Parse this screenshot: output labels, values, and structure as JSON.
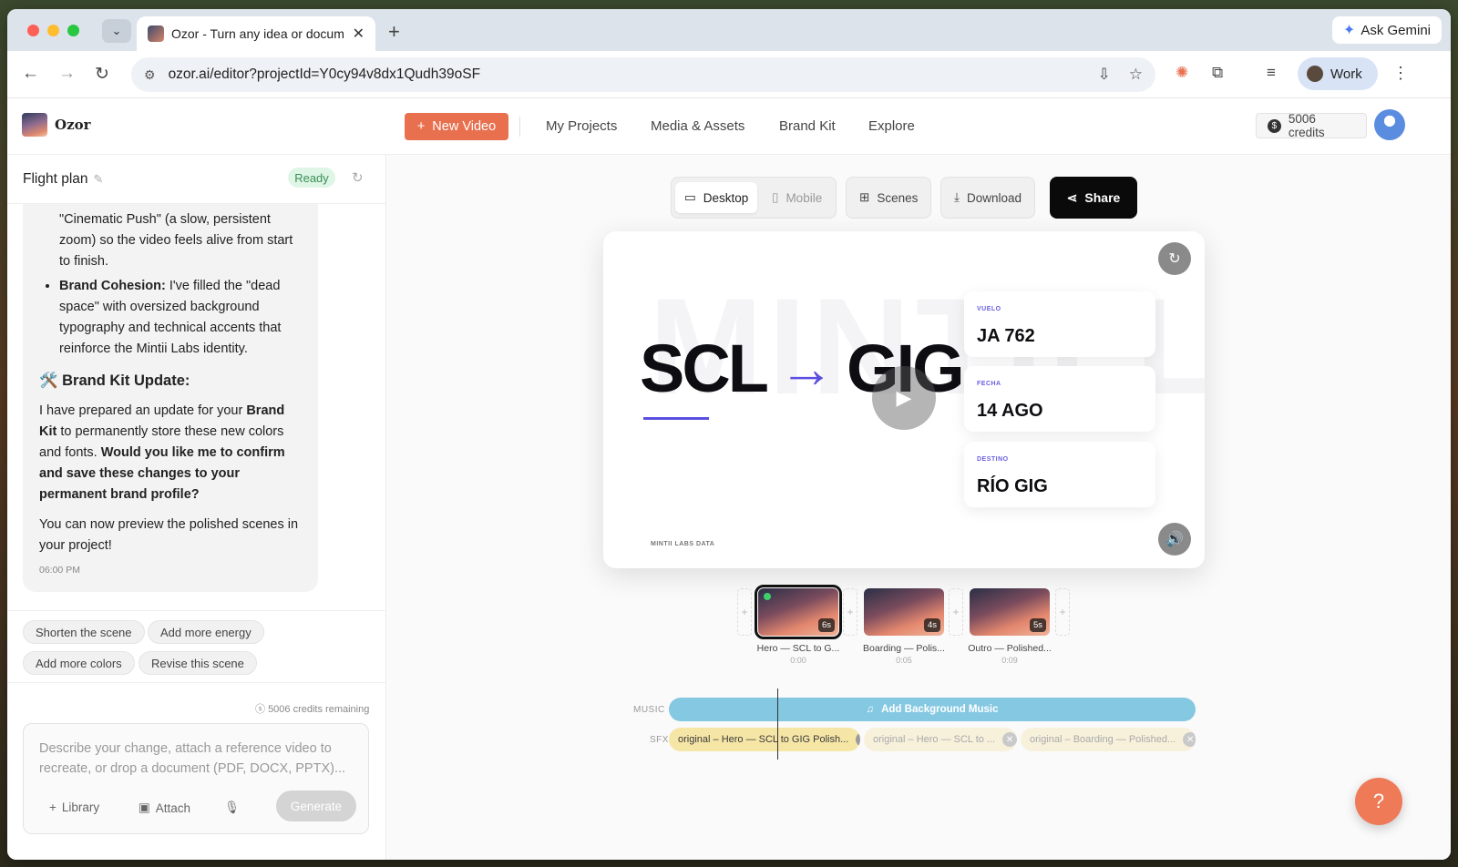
{
  "browser": {
    "tab_title": "Ozor - Turn any idea or docum",
    "url": "ozor.ai/editor?projectId=Y0cy94v8dx1Qudh39oSF",
    "ask_gemini": "Ask Gemini",
    "profile": "Work"
  },
  "app": {
    "logo": "Ozor",
    "new_video": "New Video",
    "nav": [
      "My Projects",
      "Media & Assets",
      "Brand Kit",
      "Explore"
    ],
    "credits": "5006 credits"
  },
  "chat": {
    "title": "Flight plan",
    "status": "Ready",
    "intro": "\"Cinematic Push\" (a slow, persistent zoom) so the video feels alive from start to finish.",
    "bullet_bold": "Brand Cohesion:",
    "bullet_text": " I've filled the \"dead space\" with oversized background typography and technical accents that reinforce the Mintii Labs identity.",
    "heading": "🛠️ Brand Kit Update:",
    "p1_a": "I have prepared an update for your ",
    "p1_b": "Brand Kit",
    "p1_c": " to permanently store these new colors and fonts. ",
    "p1_d": "Would you like me to confirm and save these changes to your permanent brand profile?",
    "p2": "You can now preview the polished scenes in your project!",
    "time": "06:00 PM",
    "suggestions": [
      "Shorten the scene",
      "Add more energy",
      "Add more colors",
      "Revise this scene"
    ],
    "credits_remaining": "5006 credits remaining",
    "placeholder": "Describe your change, attach a reference video to recreate, or drop a document (PDF, DOCX, PPTX)...",
    "library": "Library",
    "attach": "Attach",
    "generate": "Generate"
  },
  "editor": {
    "desktop": "Desktop",
    "mobile": "Mobile",
    "scenes": "Scenes",
    "download": "Download",
    "share": "Share",
    "preview": {
      "watermark": "MINTII LA",
      "from": "SCL",
      "arrow": "→",
      "to": "GIG",
      "cards": [
        {
          "label": "VUELO",
          "value": "JA 762"
        },
        {
          "label": "FECHA",
          "value": "14 AGO"
        },
        {
          "label": "DESTINO",
          "value": "RÍO GIG"
        }
      ],
      "footer": "MINTII LABS DATA"
    },
    "scenes_list": [
      {
        "name": "Hero — SCL to G...",
        "time": "0:00",
        "duration": "6s",
        "selected": true
      },
      {
        "name": "Boarding — Polis...",
        "time": "0:05",
        "duration": "4s",
        "selected": false
      },
      {
        "name": "Outro — Polished...",
        "time": "0:09",
        "duration": "5s",
        "selected": false
      }
    ],
    "music_label": "MUSIC",
    "sfx_label": "SFX",
    "add_music": "Add Background Music",
    "sfx_clips": [
      "original – Hero — SCL to GIG Polish...",
      "original – Hero — SCL to ...",
      "original – Boarding — Polished..."
    ]
  },
  "colors": {
    "accent": "#e8704f",
    "brand_purple": "#5b4ee0",
    "music_track": "#85c8e2",
    "sfx_track": "#f6e6a6"
  }
}
